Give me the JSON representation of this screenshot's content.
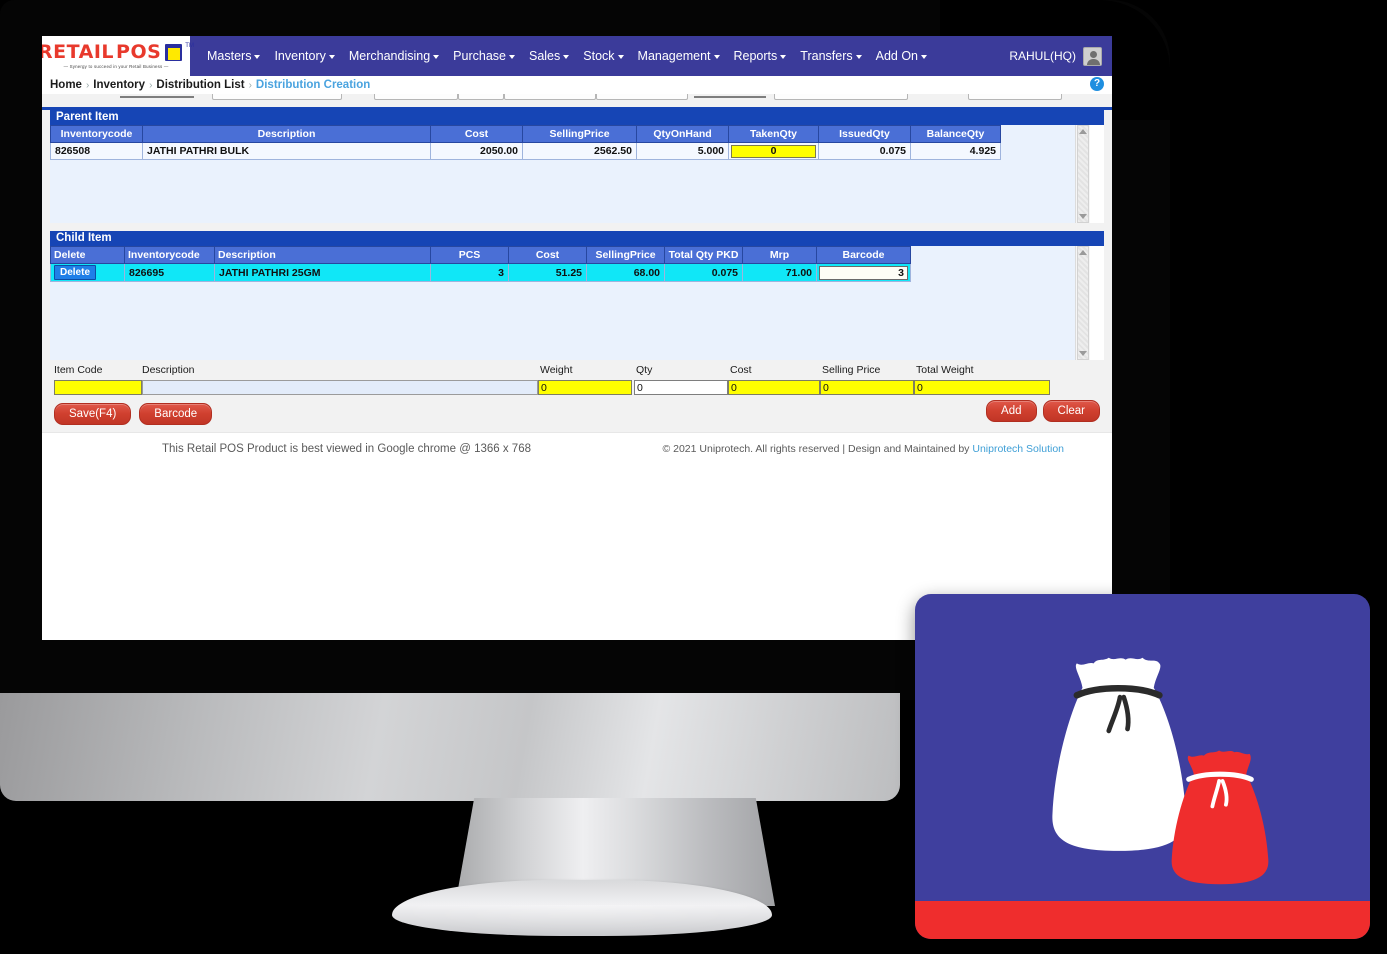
{
  "app": {
    "logo": {
      "text_left": "RETAIL",
      "text_right": "POS",
      "tm": "TM",
      "tagline": "— Synergy to succeed in your Retail Business —"
    },
    "user": "RAHUL(HQ)",
    "help": "?"
  },
  "nav": [
    {
      "label": "Masters"
    },
    {
      "label": "Inventory"
    },
    {
      "label": "Merchandising"
    },
    {
      "label": "Purchase"
    },
    {
      "label": "Sales"
    },
    {
      "label": "Stock"
    },
    {
      "label": "Management"
    },
    {
      "label": "Reports"
    },
    {
      "label": "Transfers"
    },
    {
      "label": "Add On"
    }
  ],
  "breadcrumb": {
    "items": [
      "Home",
      "Inventory",
      "Distribution List",
      "Distribution Creation"
    ],
    "separator": "›"
  },
  "parent_section": {
    "title": "Parent Item",
    "columns": [
      "Inventorycode",
      "Description",
      "Cost",
      "SellingPrice",
      "QtyOnHand",
      "TakenQty",
      "IssuedQty",
      "BalanceQty"
    ],
    "rows": [
      {
        "inventorycode": "826508",
        "description": "JATHI PATHRI BULK",
        "cost": "2050.00",
        "selling_price": "2562.50",
        "qty_on_hand": "5.000",
        "taken_qty": "0",
        "issued_qty": "0.075",
        "balance_qty": "4.925"
      }
    ]
  },
  "child_section": {
    "title": "Child Item",
    "columns": [
      "Delete",
      "Inventorycode",
      "Description",
      "PCS",
      "Cost",
      "SellingPrice",
      "Total Qty PKD",
      "Mrp",
      "Barcode"
    ],
    "rows": [
      {
        "delete_label": "Delete",
        "inventorycode": "826695",
        "description": "JATHI PATHRI 25GM",
        "pcs": "3",
        "cost": "51.25",
        "selling_price": "68.00",
        "total_qty_pkd": "0.075",
        "mrp": "71.00",
        "barcode": "3"
      }
    ]
  },
  "entry_form": {
    "labels": {
      "item_code": "Item Code",
      "description": "Description",
      "weight": "Weight",
      "qty": "Qty",
      "cost": "Cost",
      "selling_price": "Selling Price",
      "total_weight": "Total Weight"
    },
    "values": {
      "item_code": "",
      "description": "",
      "weight": "0",
      "qty": "0",
      "cost": "0",
      "selling_price": "0",
      "total_weight": "0"
    }
  },
  "buttons": {
    "save": "Save(F4)",
    "barcode": "Barcode",
    "add": "Add",
    "clear": "Clear"
  },
  "footer": {
    "left": "This Retail POS Product is best viewed in Google chrome @ 1366 x 768",
    "right_prefix": "© 2021 Uniprotech. All rights reserved | Design and Maintained by ",
    "right_link": "Uniprotech Solution"
  },
  "colors": {
    "header_blue": "#3b3b9a",
    "section_blue": "#1645b5",
    "grid_header": "#4a6fd6",
    "child_row": "#10e7f7",
    "input_yellow": "#ffff00",
    "button_red": "#d0402f",
    "promo_purple": "#3f3f9e",
    "promo_red": "#ef2d2d",
    "link_blue": "#4aa3df"
  }
}
